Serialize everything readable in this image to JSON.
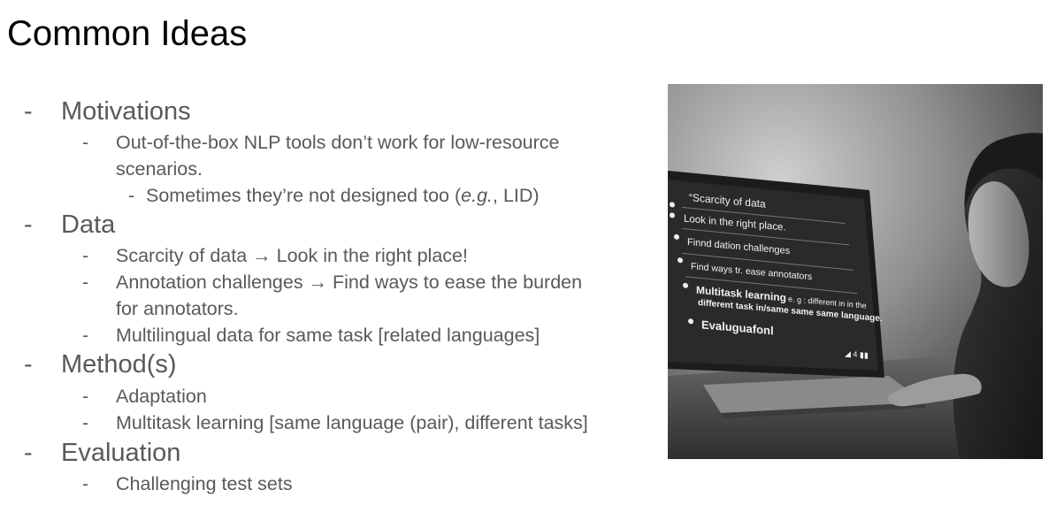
{
  "title": "Common Ideas",
  "bullet_marker": "-",
  "sections": {
    "motivations": {
      "heading": "Motivations",
      "item1_line1": "Out-of-the-box NLP tools don’t work for low-resource",
      "item1_line2": "scenarios.",
      "sub_pre": "Sometimes they’re not designed too (",
      "sub_italic": "e.g.",
      "sub_post": ", LID)"
    },
    "data": {
      "heading": "Data",
      "item1": "Scarcity of data → Look in the right place!",
      "item2_line1": "Annotation challenges → Find ways to ease the burden",
      "item2_line2": "for annotators.",
      "item3": "Multilingual data for same task [related languages]"
    },
    "methods": {
      "heading": "Method(s)",
      "item1": "Adaptation",
      "item2": "Multitask learning [same language (pair), different tasks]"
    },
    "evaluation": {
      "heading": "Evaluation",
      "item1": "Challenging test sets"
    }
  },
  "photo_screen": {
    "line1": "“Scarcity of data",
    "line2": "Look in the right place.",
    "line3": "Finnd dation challenges",
    "line4": "Find ways tr. ease annotators",
    "line5a": "Multitask learning",
    "line5b": "e. g : different in in the",
    "line6": "different task in/same same same language.",
    "line7": "Evaluguafonl",
    "status": "◢ 4 ▮▮"
  }
}
